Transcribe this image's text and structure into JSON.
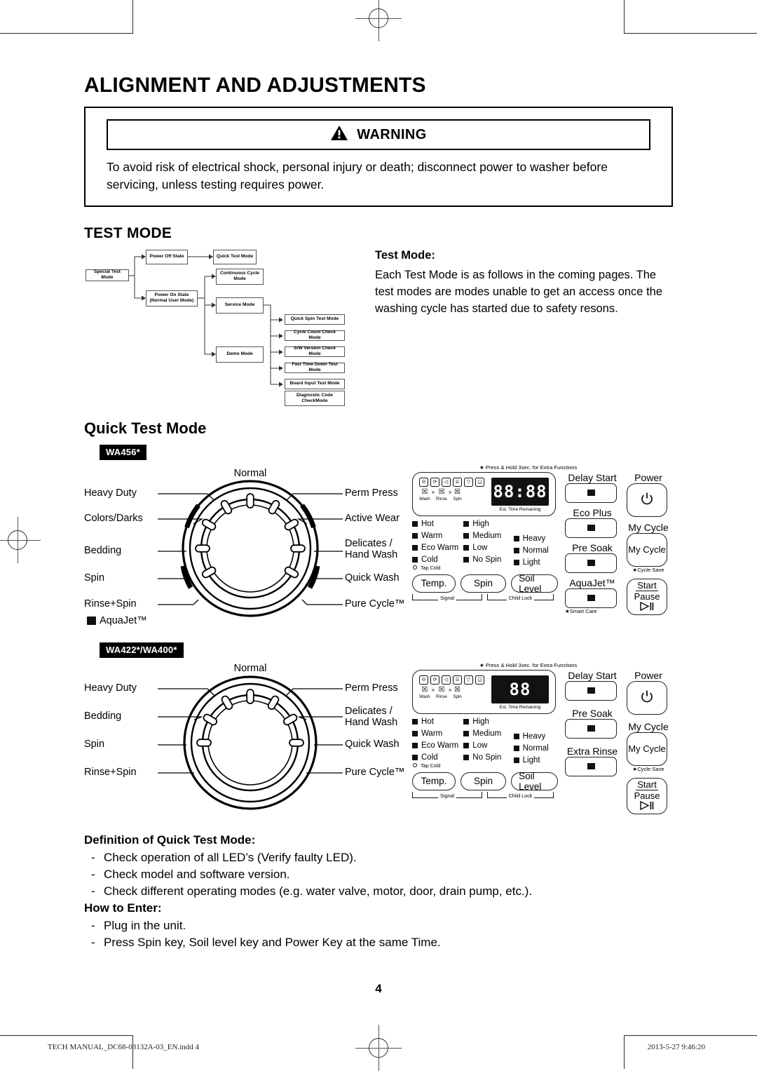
{
  "page": {
    "title": "ALIGNMENT AND ADJUSTMENTS",
    "number": "4"
  },
  "warning": {
    "label": "WARNING",
    "icon": "warning-triangle-icon",
    "body": "To avoid risk of electrical shock, personal injury or death; disconnect power to washer before servicing, unless testing requires power."
  },
  "test_mode": {
    "heading": "TEST MODE",
    "note_heading": "Test Mode:",
    "note_body": "Each Test Mode is as follows in the coming pages. The test modes are modes unable to get an access once the washing cycle has started due to safety resons.",
    "flow": {
      "root": "Special Test Mode",
      "power_off": "Power Off State",
      "quick_test": "Quick Test Mode",
      "power_on": "Power On State (Normal User Mode)",
      "continuous": "Continuous Cycle Mode",
      "service": "Service Mode",
      "demo": "Demo Mode",
      "service_children": [
        "Quick Spin Test Mode",
        "Cycle Count Check Mode",
        "S/W Version Check Mode",
        "Fast Time Down Test Mode",
        "Board Input Test Mode",
        "Diagnostic Code CheckMode"
      ]
    }
  },
  "quick_test_mode": {
    "heading": "Quick Test Mode",
    "models": [
      {
        "badge": "WA456*",
        "dial": {
          "left": [
            "Heavy Duty",
            "Colors/Darks",
            "Bedding",
            "Spin",
            "Rinse+Spin"
          ],
          "top": "Normal",
          "right": [
            "Perm Press",
            "Active Wear",
            "Delicates / Hand Wash",
            "Quick Wash",
            "Pure Cycle™"
          ],
          "footnote": "AquaJet™",
          "footnote_icon": "aquajet-icon"
        },
        "panel": {
          "extra_functions_note": "★ Press & Hold 3sec. for Extra Functions",
          "status_icons": [
            "child-lock-icon",
            "eco-icon",
            "sound-icon",
            "lock-icon",
            "water-icon",
            "delay-icon"
          ],
          "progress": [
            "Wash",
            "Rinse",
            "Spin"
          ],
          "display_value": "88:88",
          "display_caption": "Est. Time Remaining",
          "temp_leds": [
            "Hot",
            "Warm",
            "Eco Warm",
            "Cold"
          ],
          "temp_sub": "Tap Cold",
          "spin_leds": [
            "High",
            "Medium",
            "Low",
            "No Spin"
          ],
          "soil_leds": [
            "Heavy",
            "Normal",
            "Light"
          ],
          "pill_buttons": [
            "Temp.",
            "Spin",
            "Soil Level"
          ],
          "under_labels": [
            "Signal",
            "Child Lock"
          ],
          "option_buttons": [
            {
              "label": "Delay Start",
              "note": ""
            },
            {
              "label": "Eco Plus",
              "note": ""
            },
            {
              "label": "Pre Soak",
              "note": ""
            },
            {
              "label": "AquaJet™",
              "note": "★Smart Care"
            }
          ],
          "right_buttons": [
            {
              "label": "Power",
              "glyph": "power-icon",
              "note": ""
            },
            {
              "label": "My Cycle",
              "glyph": "",
              "note": "★Cycle Save"
            },
            {
              "label": "Start Pause",
              "glyph": "play-pause-icon",
              "note": ""
            }
          ]
        }
      },
      {
        "badge": "WA422*/WA400*",
        "dial": {
          "left": [
            "Heavy Duty",
            "Bedding",
            "Spin",
            "Rinse+Spin"
          ],
          "top": "Normal",
          "right": [
            "Perm Press",
            "Delicates / Hand Wash",
            "Quick Wash",
            "Pure Cycle™"
          ],
          "footnote": "",
          "footnote_icon": ""
        },
        "panel": {
          "extra_functions_note": "★ Press & Hold 3sec. for Extra Functions",
          "status_icons": [
            "child-lock-icon",
            "eco-icon",
            "sound-icon",
            "lock-icon",
            "water-icon",
            "delay-icon"
          ],
          "progress": [
            "Wash",
            "Rinse",
            "Spin"
          ],
          "display_value": "88",
          "display_caption": "Est. Time Remaining",
          "temp_leds": [
            "Hot",
            "Warm",
            "Eco Warm",
            "Cold"
          ],
          "temp_sub": "Tap Cold",
          "spin_leds": [
            "High",
            "Medium",
            "Low",
            "No Spin"
          ],
          "soil_leds": [
            "Heavy",
            "Normal",
            "Light"
          ],
          "pill_buttons": [
            "Temp.",
            "Spin",
            "Soil Level"
          ],
          "under_labels": [
            "Signal",
            "Child Lock"
          ],
          "option_buttons": [
            {
              "label": "Delay Start",
              "note": ""
            },
            {
              "label": "Pre Soak",
              "note": ""
            },
            {
              "label": "Extra Rinse",
              "note": ""
            }
          ],
          "right_buttons": [
            {
              "label": "Power",
              "glyph": "power-icon",
              "note": ""
            },
            {
              "label": "My Cycle",
              "glyph": "",
              "note": "★Cycle Save"
            },
            {
              "label": "Start Pause",
              "glyph": "play-pause-icon",
              "note": ""
            }
          ]
        }
      }
    ]
  },
  "definition": {
    "heading": "Definition of Quick Test Mode:",
    "items": [
      "Check operation of all LED’s (Verify faulty LED).",
      "Check model and software version.",
      "Check different operating modes (e.g. water valve, motor, door, drain pump, etc.)."
    ],
    "enter_heading": "How to Enter:",
    "enter_items": [
      "Plug in the unit.",
      "Press Spin key, Soil level key and Power Key at the same Time."
    ]
  },
  "footer": {
    "left": "TECH MANUAL_DC68-03132A-03_EN.indd  4",
    "right": "2013-5-27   9:46:20"
  }
}
